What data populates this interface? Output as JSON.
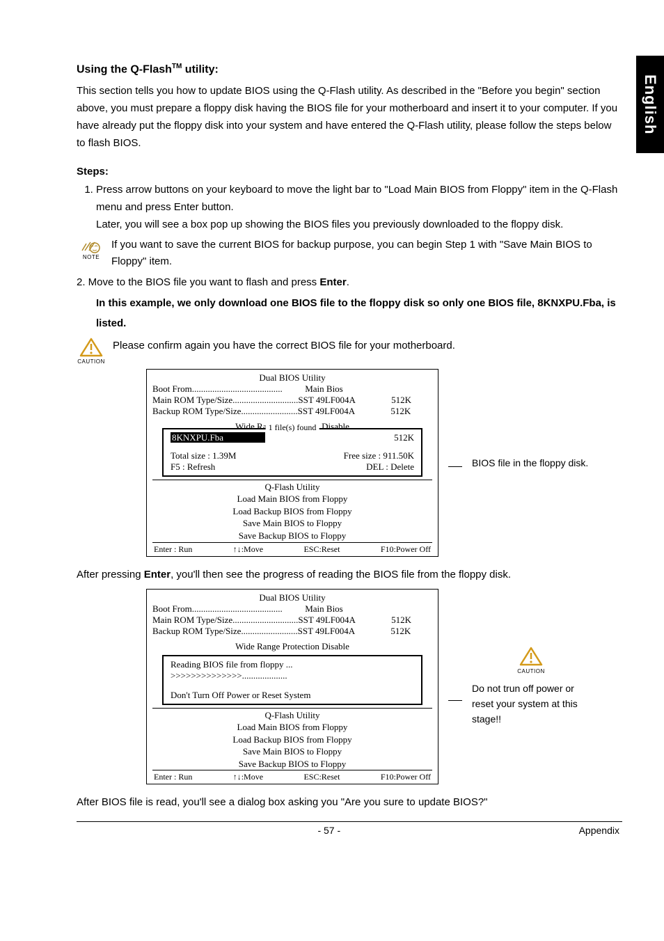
{
  "sideTab": "English",
  "heading": "Using the Q-Flash",
  "headingSup": "TM",
  "headingTail": " utility:",
  "intro": "This section tells you how to update BIOS using the Q-Flash utility. As described in the \"Before you begin\" section above, you must prepare a floppy disk having the BIOS file for your motherboard and insert it to your computer. If you have already put the floppy disk into your system and have entered the Q-Flash utility, please follow the steps below to flash BIOS.",
  "stepsLabel": "Steps:",
  "step1a": "Press arrow buttons on your keyboard to move the light bar to \"Load Main BIOS from Floppy\" item in the Q-Flash menu and press Enter button.",
  "step1b": "Later, you will see a box pop up showing the BIOS files you previously downloaded to the floppy disk.",
  "noteText": "If you want to save the current BIOS for backup purpose, you can begin Step 1 with \"Save Main BIOS to Floppy\" item.",
  "step2Pre": "2. Move to the BIOS file you want to flash and press ",
  "step2Bold": "Enter",
  "step2Post": ".",
  "exampleLine": "In this example, we only download one BIOS file to the floppy disk so only one BIOS file, 8KNXPU.Fba, is listed.",
  "cautionText": "Please confirm again you have the correct BIOS file for your motherboard.",
  "noteLabel": "NOTE",
  "cautionLabel": "CAUTION",
  "bios1": {
    "title": "Dual BIOS Utility",
    "boot": "Boot From........................................          Main Bios",
    "mainRom": "Main ROM Type/Size.............................SST 49LF004A                512K",
    "backupRom": "Backup ROM Type/Size.........................SST 49LF004A                512K",
    "wide": "Wide Range Protection    Disable",
    "popTitle": "1 file(s) found",
    "file": "8KNXPU.Fba",
    "fileSize": "512K",
    "total": "Total size : 1.39M",
    "free": "Free size : 911.50K",
    "f5": "F5 : Refresh",
    "del": "DEL : Delete",
    "qflash": "Q-Flash Utility",
    "m1": "Load Main BIOS from Floppy",
    "m2": "Load Backup BIOS from Floppy",
    "m3": "Save Main BIOS to Floppy",
    "m4": "Save Backup BIOS to Floppy",
    "f_enter": "Enter : Run",
    "f_move": "↑↓:Move",
    "f_esc": "ESC:Reset",
    "f_f10": "F10:Power Off"
  },
  "callout1": "BIOS file in the floppy disk.",
  "afterEnterPre": "After pressing ",
  "afterEnterBold": "Enter",
  "afterEnterPost": ", you'll then see the progress of reading the BIOS file from the floppy disk.",
  "bios2": {
    "title": "Dual BIOS Utility",
    "boot": "Boot From........................................          Main Bios",
    "mainRom": "Main ROM Type/Size.............................SST 49LF004A                512K",
    "backupRom": "Backup ROM Type/Size.........................SST 49LF004A                512K",
    "wide": "Wide Range Protection    Disable",
    "reading": "Reading BIOS file from floppy ...",
    "progress": ">>>>>>>>>>>>>>....................",
    "dont": "Don't Turn Off Power or Reset System",
    "qflash": "Q-Flash Utility",
    "m1": "Load Main BIOS from Floppy",
    "m2": "Load Backup BIOS from Floppy",
    "m3": "Save Main BIOS to Floppy",
    "m4": "Save Backup BIOS to Floppy",
    "f_enter": "Enter : Run",
    "f_move": "↑↓:Move",
    "f_esc": "ESC:Reset",
    "f_f10": "F10:Power Off"
  },
  "callout2": "Do not trun off power or reset your system at this stage!!",
  "afterRead": "After BIOS file is read, you'll see a  dialog box asking you \"Are you sure to update BIOS?\"",
  "pageNum": "- 57 -",
  "appendix": "Appendix"
}
